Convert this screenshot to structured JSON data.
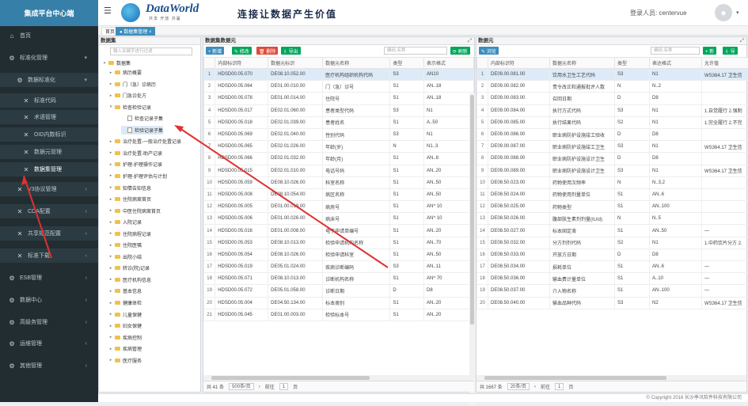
{
  "app": {
    "title": "集成平台中心端"
  },
  "brand": {
    "name": "DataWorld",
    "sub": "共享 开放 共赢",
    "slogan": "连接让数据产生价值"
  },
  "user": {
    "label": "登录人员: centervue"
  },
  "sidebar": [
    {
      "label": "首页",
      "icon": "home-icon",
      "level": 0
    },
    {
      "label": "标准化管理",
      "icon": "gear-icon",
      "level": 0,
      "arrow": "▾"
    },
    {
      "label": "数据标准化",
      "icon": "gear-icon",
      "level": 1,
      "arrow": "▾"
    },
    {
      "label": "标准代码",
      "icon": "wrench-icon",
      "level": 2
    },
    {
      "label": "术语管理",
      "icon": "wrench-icon",
      "level": 2
    },
    {
      "label": "OID内数标识",
      "icon": "wrench-icon",
      "level": 2
    },
    {
      "label": "数据元管理",
      "icon": "wrench-icon",
      "level": 2
    },
    {
      "label": "数据集管理",
      "icon": "wrench-icon",
      "level": 2,
      "active": true
    },
    {
      "label": "V3协议管理",
      "icon": "wrench-icon",
      "level": 1,
      "arrow": "‹"
    },
    {
      "label": "CDA配置",
      "icon": "wrench-icon",
      "level": 1,
      "arrow": "‹"
    },
    {
      "label": "共享规范配置",
      "icon": "wrench-icon",
      "level": 1,
      "arrow": "‹"
    },
    {
      "label": "标准下载",
      "icon": "wrench-icon",
      "level": 1,
      "arrow": "‹"
    },
    {
      "label": "ESB管理",
      "icon": "gear-icon",
      "level": 0,
      "arrow": "‹"
    },
    {
      "label": "数据中心",
      "icon": "gear-icon",
      "level": 0,
      "arrow": "‹"
    },
    {
      "label": "高级务管理",
      "icon": "gear-icon",
      "level": 0,
      "arrow": "‹"
    },
    {
      "label": "运维管理",
      "icon": "gear-icon",
      "level": 0,
      "arrow": "‹"
    },
    {
      "label": "其他管理",
      "icon": "gear-icon",
      "level": 0,
      "arrow": "‹"
    }
  ],
  "tabs": [
    {
      "label": "首页"
    },
    {
      "label": "● 数据集管理 ×"
    }
  ],
  "dataset_panel": {
    "title": "数据集",
    "search_placeholder": "输入关键字进行过滤",
    "root": "数据集",
    "nodes": [
      {
        "label": "病历概要",
        "type": "folder",
        "depth": 1
      },
      {
        "label": "门（急）诊病历",
        "type": "folder",
        "depth": 1
      },
      {
        "label": "门急诊处方",
        "type": "folder",
        "depth": 1
      },
      {
        "label": "检查检验记录",
        "type": "folder",
        "depth": 1,
        "open": true
      },
      {
        "label": "检查记录子集",
        "type": "file",
        "depth": 2
      },
      {
        "label": "检验记录子集",
        "type": "file",
        "depth": 2,
        "selected": true
      },
      {
        "label": "治疗处置-一般治疗处置记录",
        "type": "folder",
        "depth": 1
      },
      {
        "label": "治疗处置-助产记录",
        "type": "folder",
        "depth": 1
      },
      {
        "label": "护理-护理操作记录",
        "type": "folder",
        "depth": 1
      },
      {
        "label": "护理-护理评估与计划",
        "type": "folder",
        "depth": 1
      },
      {
        "label": "知情告知信息",
        "type": "folder",
        "depth": 1
      },
      {
        "label": "住院病案首页",
        "type": "folder",
        "depth": 1
      },
      {
        "label": "中医住院病案首页",
        "type": "folder",
        "depth": 1
      },
      {
        "label": "入院记录",
        "type": "folder",
        "depth": 1
      },
      {
        "label": "住院病程记录",
        "type": "folder",
        "depth": 1
      },
      {
        "label": "住院医嘱",
        "type": "folder",
        "depth": 1
      },
      {
        "label": "出院小结",
        "type": "folder",
        "depth": 1
      },
      {
        "label": "转诊(院)记录",
        "type": "folder",
        "depth": 1
      },
      {
        "label": "医疗机构信息",
        "type": "folder",
        "depth": 1
      },
      {
        "label": "基本信息",
        "type": "folder",
        "depth": 1
      },
      {
        "label": "健康体检",
        "type": "folder",
        "depth": 1
      },
      {
        "label": "儿童保健",
        "type": "folder",
        "depth": 1
      },
      {
        "label": "妇女保健",
        "type": "folder",
        "depth": 1
      },
      {
        "label": "疾病控制",
        "type": "folder",
        "depth": 1
      },
      {
        "label": "疾病管理",
        "type": "folder",
        "depth": 1
      },
      {
        "label": "医疗服务",
        "type": "folder",
        "depth": 1
      }
    ]
  },
  "element_panel": {
    "title": "数据集数据元",
    "buttons": {
      "add": "+ 新增",
      "edit": "✎ 修改",
      "del": "🗑 删除",
      "export": "⇩ 导出"
    },
    "search_placeholder": "编码,名称",
    "refresh": "⟳ 刷新",
    "columns": [
      "",
      "内部标识符",
      "数据元标识",
      "数据元名称",
      "类型",
      "表示格式"
    ],
    "rows": [
      [
        "1",
        "HDSD00.05.070",
        "DE08.10.052.00",
        "医疗机构组织机构代码",
        "S3",
        "AN10"
      ],
      [
        "2",
        "HDSD00.05.064",
        "DE01.00.010.00",
        "门（急）诊号",
        "S1",
        "AN..18"
      ],
      [
        "3",
        "HDSD00.05.078",
        "DE01.00.014.00",
        "住院号",
        "S1",
        "AN..18"
      ],
      [
        "4",
        "HDSD00.05.017",
        "DE02.01.060.00",
        "患者类型代码",
        "S3",
        "N1"
      ],
      [
        "5",
        "HDSD00.05.018",
        "DE02.01.039.00",
        "患者姓名",
        "S1",
        "A..50"
      ],
      [
        "6",
        "HDSD00.05.069",
        "DE02.01.040.00",
        "性别代码",
        "S3",
        "N1"
      ],
      [
        "7",
        "HDSD00.05.065",
        "DE02.01.026.00",
        "年龄(岁)",
        "N",
        "N1..3"
      ],
      [
        "8",
        "HDSD00.05.066",
        "DE02.01.032.00",
        "年龄(月)",
        "S1",
        "AN..8"
      ],
      [
        "9",
        "HDSD00.05.015",
        "DE02.01.010.00",
        "电话号码",
        "S1",
        "AN..20"
      ],
      [
        "10",
        "HDSD00.05.059",
        "DE08.10.026.00",
        "科室名称",
        "S1",
        "AN..50"
      ],
      [
        "11",
        "HDSD00.05.008",
        "DE08.10.054.00",
        "病区名称",
        "S1",
        "AN..50"
      ],
      [
        "12",
        "HDSD00.05.005",
        "DE01.00.019.00",
        "病房号",
        "S1",
        "AN^ 10"
      ],
      [
        "13",
        "HDSD00.05.006",
        "DE01.00.026.00",
        "病床号",
        "S1",
        "AN^ 10"
      ],
      [
        "14",
        "HDSD00.05.016",
        "DE01.00.008.00",
        "电子申请单编号",
        "S1",
        "AN..20"
      ],
      [
        "15",
        "HDSD00.05.053",
        "DE08.10.013.00",
        "检验申请机构名称",
        "S1",
        "AN..70"
      ],
      [
        "16",
        "HDSD00.05.054",
        "DE08.10.026.00",
        "检验申请科室",
        "S1",
        "AN..50"
      ],
      [
        "17",
        "HDSD00.05.019",
        "DE05.01.024.00",
        "疾病诊断编码",
        "S3",
        "AN..11"
      ],
      [
        "18",
        "HDSD00.05.071",
        "DE08.10.013.00",
        "诊断机构名称",
        "S1",
        "AN^ 70"
      ],
      [
        "19",
        "HDSD00.05.072",
        "DE05.01.058.00",
        "诊断日期",
        "D",
        "D8"
      ],
      [
        "20",
        "HDSD00.05.004",
        "DE04.50.134.00",
        "标本类别",
        "S1",
        "AN..20"
      ],
      [
        "21",
        "HDSD00.05.045",
        "DE01.00.003.00",
        "检验标本号",
        "S1",
        "AN..20"
      ]
    ],
    "pager": {
      "total": "共 41 条",
      "size": "500条/页",
      "prev": "‹",
      "goto": "前往",
      "page": "1",
      "unit": "页"
    }
  },
  "meta_panel": {
    "title": "数据元",
    "buttons": {
      "browse": "✎ 浏览"
    },
    "search_placeholder": "编码,名称",
    "refresh": "⟳ 刷新",
    "extra": [
      "+ 新",
      "⇩ 导"
    ],
    "columns": [
      "",
      "内部标识符",
      "数据元名称",
      "类型",
      "表达格式",
      "允许值"
    ],
    "rows": [
      [
        "1",
        "DE09.00.081.00",
        "饮用水卫生工艺代码",
        "S3",
        "N1",
        "WS364.17 卫生信"
      ],
      [
        "2",
        "DE09.00.082.00",
        "责令改正和通报批评人数",
        "N",
        "N..2",
        ""
      ],
      [
        "3",
        "DE09.00.083.00",
        "召回日期",
        "D",
        "D8",
        ""
      ],
      [
        "4",
        "DE09.00.084.00",
        "执行方式代码",
        "S3",
        "N1",
        "1.自觉履行 2.强制"
      ],
      [
        "5",
        "DE09.00.085.00",
        "执行结果代码",
        "S2",
        "N1",
        "1.完全履行 2.不完"
      ],
      [
        "6",
        "DE09.00.086.00",
        "职业病防护设施竣工验收",
        "D",
        "D8",
        ""
      ],
      [
        "7",
        "DE09.00.087.00",
        "职业病防护设施竣工卫生",
        "S3",
        "N1",
        "WS364.17 卫生信"
      ],
      [
        "8",
        "DE09.00.088.00",
        "职业病防护设施设计卫生",
        "D",
        "D8",
        ""
      ],
      [
        "9",
        "DE09.00.089.00",
        "职业病防护设施设计卫生",
        "S3",
        "N1",
        "WS364.17 卫生信"
      ],
      [
        "10",
        "DE08.50.023.00",
        "药物使用次频率",
        "N",
        "N..3,2",
        ""
      ],
      [
        "11",
        "DE08.50.024.00",
        "药物使用剂量单位",
        "S1",
        "AN..6",
        ""
      ],
      [
        "12",
        "DE08.50.025.00",
        "药物类型",
        "S1",
        "AN..100",
        ""
      ],
      [
        "13",
        "DE08.50.026.00",
        "腹部肤生素剂剂量(IU/d)",
        "N",
        "N..5",
        ""
      ],
      [
        "14",
        "DE08.50.027.00",
        "标本固定液",
        "S1",
        "AN..50",
        "—"
      ],
      [
        "15",
        "DE08.50.032.00",
        "分方剂剂代码",
        "S2",
        "N1",
        "1.中药饮片分方 2."
      ],
      [
        "16",
        "DE08.50.033.00",
        "开放方日期",
        "D",
        "D8",
        ""
      ],
      [
        "17",
        "DE08.50.034.00",
        "损耗单位",
        "S1",
        "AN..6",
        "—"
      ],
      [
        "18",
        "DE08.50.036.00",
        "输血费计量单位",
        "S1",
        "A..10",
        "—"
      ],
      [
        "19",
        "DE08.50.037.00",
        "介入物名称",
        "S1",
        "AN..100",
        "—"
      ],
      [
        "20",
        "DE08.50.040.00",
        "输血品种代码",
        "S3",
        "N2",
        "WS364.17 卫生信"
      ]
    ],
    "pager": {
      "total": "共 1667 条",
      "size": "20条/页",
      "prev": "‹",
      "goto": "前往",
      "page": "1",
      "unit": "页"
    }
  },
  "footer": {
    "text": "© Copyright 2016 长沙季讯软件科技有限公司"
  }
}
